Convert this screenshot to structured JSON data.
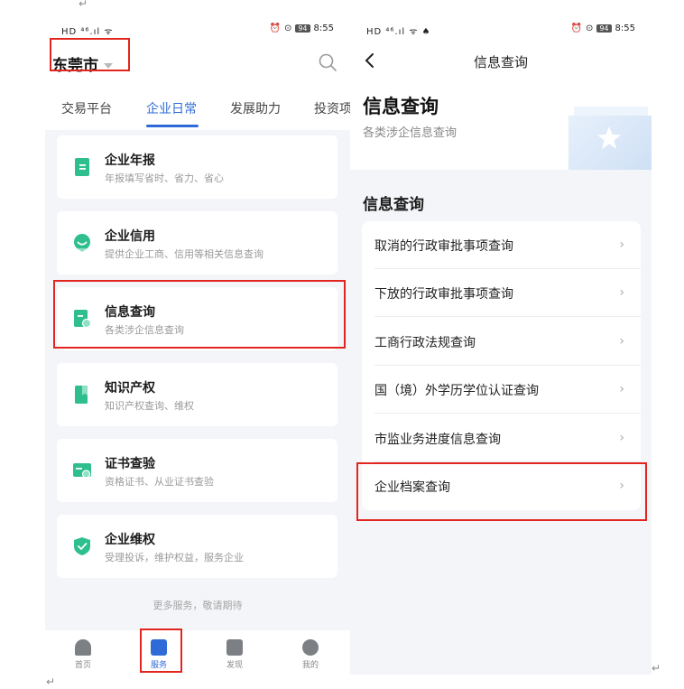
{
  "left_screen": {
    "status": {
      "left": "HD ⁴⁶.ıl ᯤ",
      "battery": "94",
      "time": "8:55"
    },
    "city": "东莞市",
    "tabs": [
      "交易平台",
      "企业日常",
      "发展助力",
      "投资项"
    ],
    "cards": [
      {
        "title": "企业年报",
        "subtitle": "年报填写省时、省力、省心",
        "icon": "report-icon"
      },
      {
        "title": "企业信用",
        "subtitle": "提供企业工商、信用等相关信息查询",
        "icon": "credit-icon"
      },
      {
        "title": "信息查询",
        "subtitle": "各类涉企信息查询",
        "icon": "info-query-icon"
      },
      {
        "title": "知识产权",
        "subtitle": "知识产权查询、维权",
        "icon": "ip-icon"
      },
      {
        "title": "证书查验",
        "subtitle": "资格证书、从业证书查验",
        "icon": "certificate-icon"
      },
      {
        "title": "企业维权",
        "subtitle": "受理投诉，维护权益，服务企业",
        "icon": "shield-icon"
      }
    ],
    "more_text": "更多服务，敬请期待",
    "nav": [
      "首页",
      "服务",
      "发现",
      "我的"
    ]
  },
  "right_screen": {
    "status": {
      "left": "HD ⁴⁶.ıl ᯤ ♠",
      "battery": "94",
      "time": "8:55"
    },
    "title": "信息查询",
    "hero_title": "信息查询",
    "hero_subtitle": "各类涉企信息查询",
    "section_title": "信息查询",
    "items": [
      "取消的行政审批事项查询",
      "下放的行政审批事项查询",
      "工商行政法规查询",
      "国（境）外学历学位认证查询",
      "市监业务进度信息查询",
      "企业档案查询"
    ]
  },
  "colors": {
    "accent": "#2f6bd8",
    "icon_green": "#2fbf8f",
    "highlight": "#e2261f"
  },
  "para_mark": "↵"
}
